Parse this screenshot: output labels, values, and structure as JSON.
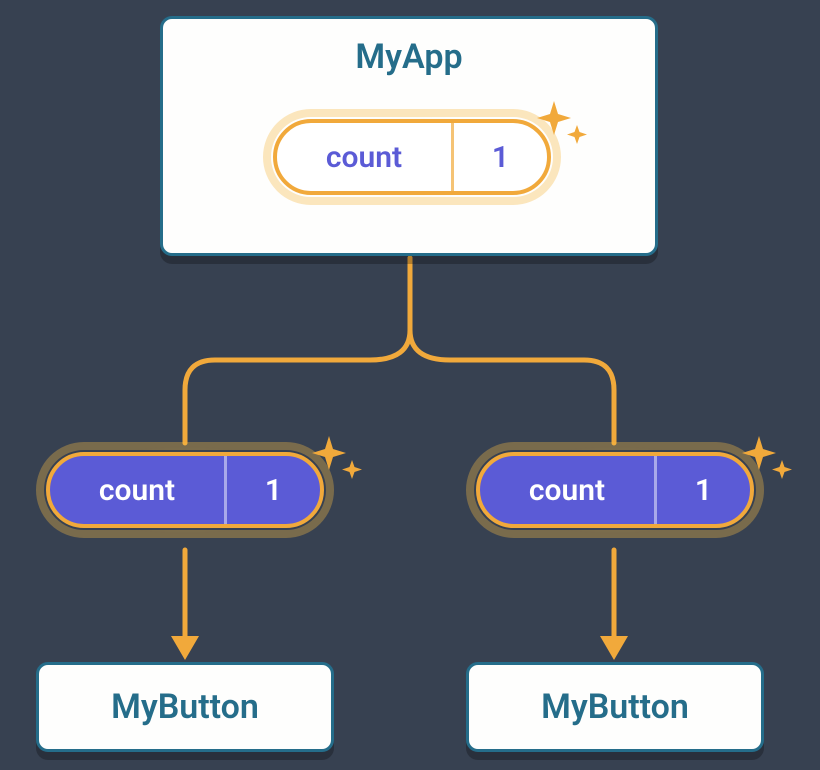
{
  "colors": {
    "background": "#374151",
    "card_border": "#256d8a",
    "card_bg": "#fefefd",
    "accent": "#f1a93b",
    "purple": "#5b5bd6"
  },
  "root": {
    "title": "MyApp",
    "state": {
      "label": "count",
      "value": "1"
    }
  },
  "props": {
    "left": {
      "label": "count",
      "value": "1"
    },
    "right": {
      "label": "count",
      "value": "1"
    }
  },
  "children": {
    "left": {
      "title": "MyButton"
    },
    "right": {
      "title": "MyButton"
    }
  }
}
